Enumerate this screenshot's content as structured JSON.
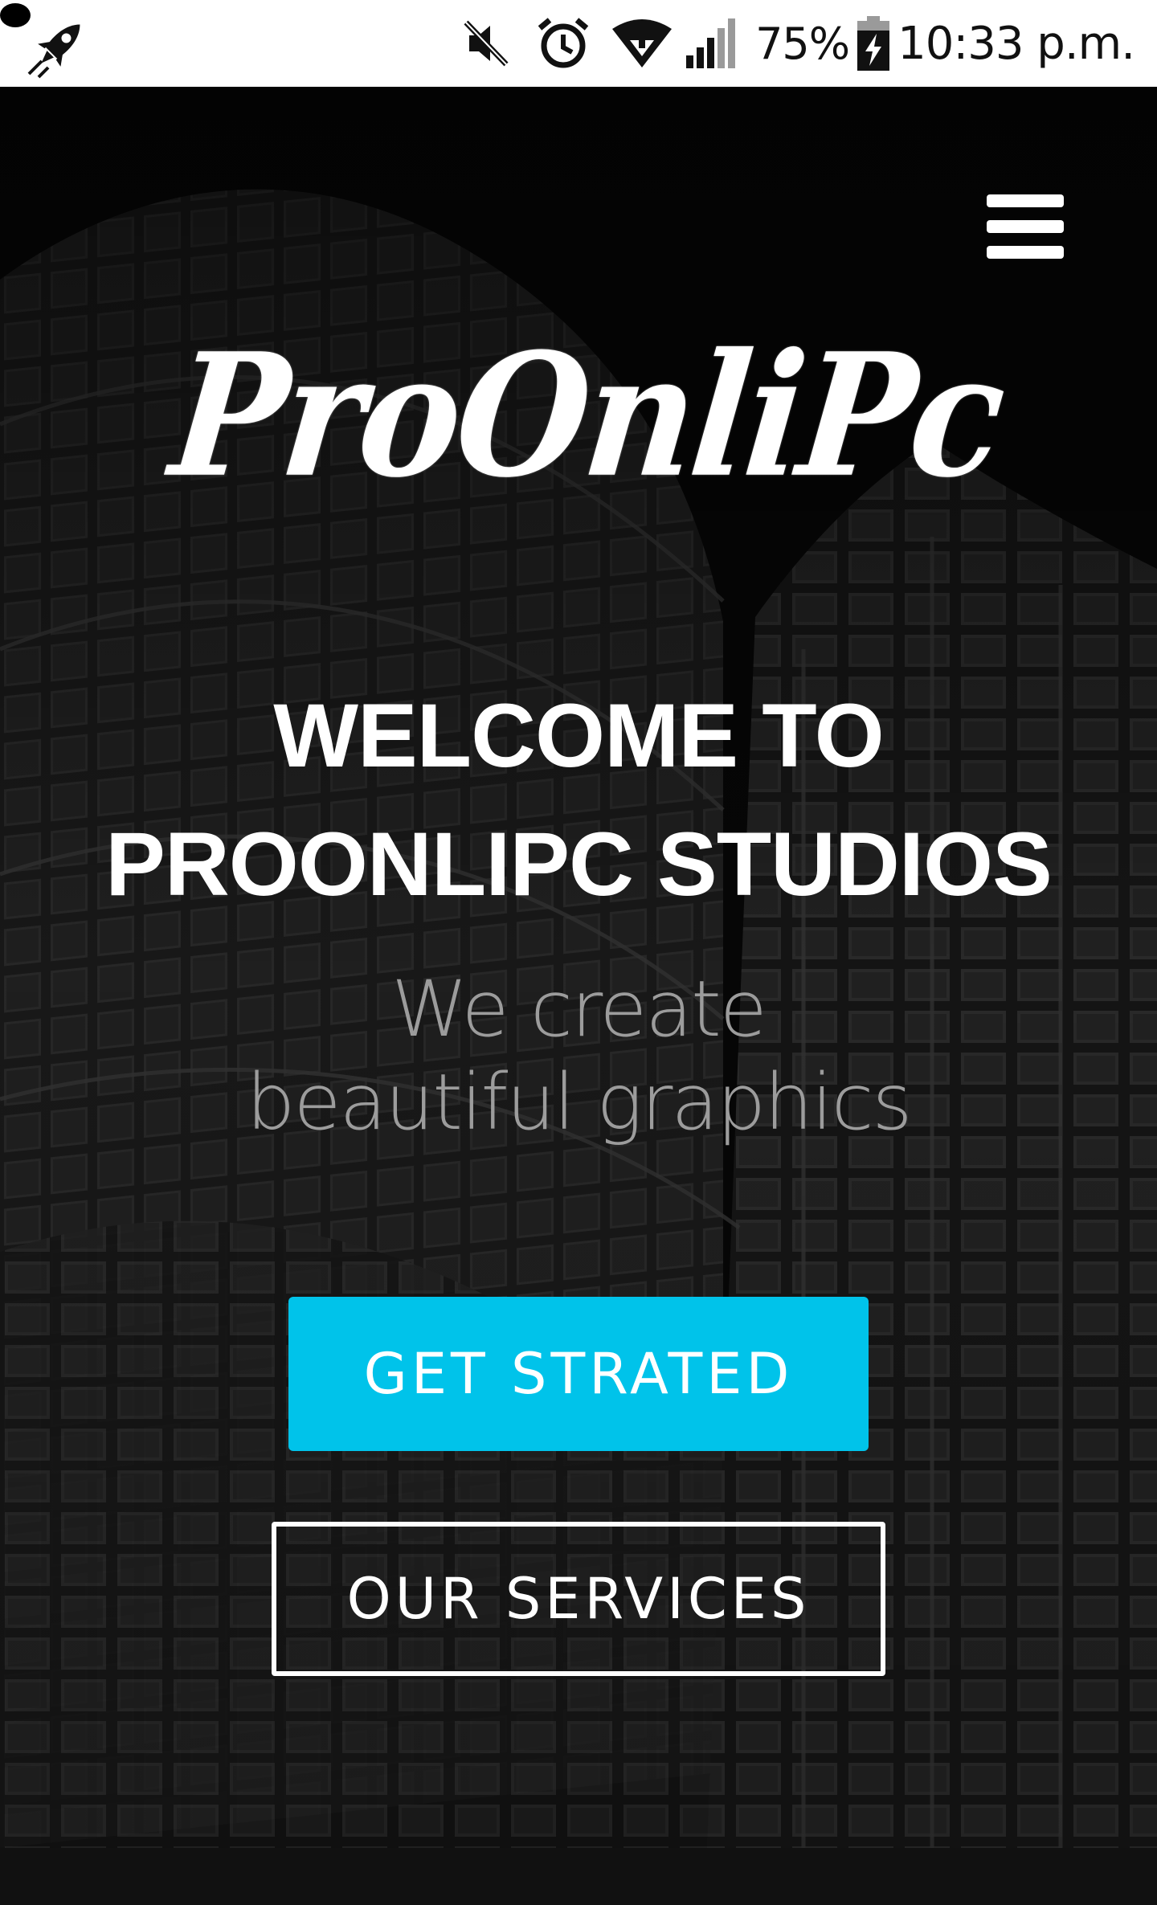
{
  "status_bar": {
    "left_icon": "rocket-icon",
    "icons": [
      "mute-icon",
      "alarm-icon",
      "wifi-icon",
      "signal-icon",
      "battery-charging-icon"
    ],
    "battery": "75%",
    "time": "10:33 p.m."
  },
  "header": {
    "menu_icon": "hamburger-menu-icon",
    "logo_text": "ProOnliPc"
  },
  "hero": {
    "title_line1": "WELCOME TO",
    "title_line2": "PROONLIPC STUDIOS",
    "subtitle_line1": "We create",
    "subtitle_line2": "beautiful graphics",
    "primary_button": "GET STRATED",
    "secondary_button": "OUR SERVICES"
  },
  "colors": {
    "accent": "#00c3ea",
    "background": "#0b0b0b",
    "subtitle": "#9c9c9c",
    "text": "#ffffff"
  }
}
